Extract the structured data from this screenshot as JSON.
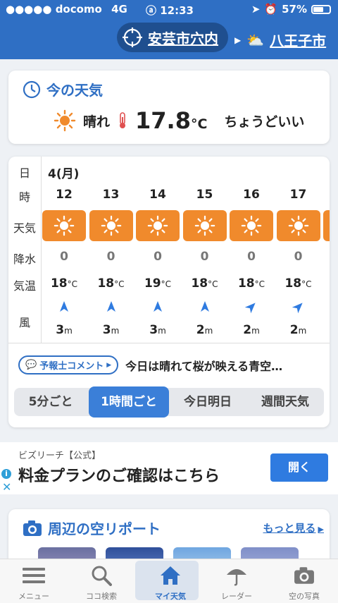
{
  "status": {
    "carrier": "docomo",
    "network": "4G",
    "time": "12:33",
    "battery": "57%",
    "battery_level": 0.57
  },
  "location": {
    "current": "安芸市穴内",
    "next": "八王子市"
  },
  "now": {
    "title": "今の天気",
    "weather": "晴れ",
    "temp": "17.8",
    "unit": "°C",
    "feel": "ちょうどいい"
  },
  "forecast": {
    "labels": {
      "day": "日",
      "hour": "時",
      "weather": "天気",
      "precip": "降水",
      "temp": "気温",
      "wind": "風"
    },
    "date": "4(月)",
    "hours": [
      {
        "hour": "12",
        "precip": "0",
        "temp": "18",
        "wind": "3",
        "dir": "north"
      },
      {
        "hour": "13",
        "precip": "0",
        "temp": "18",
        "wind": "3",
        "dir": "north"
      },
      {
        "hour": "14",
        "precip": "0",
        "temp": "19",
        "wind": "3",
        "dir": "north"
      },
      {
        "hour": "15",
        "precip": "0",
        "temp": "18",
        "wind": "2",
        "dir": "north"
      },
      {
        "hour": "16",
        "precip": "0",
        "temp": "18",
        "wind": "2",
        "dir": "northeast"
      },
      {
        "hour": "17",
        "precip": "0",
        "temp": "18",
        "wind": "2",
        "dir": "northeast"
      }
    ],
    "temp_unit": "°C",
    "wind_unit": "m"
  },
  "comment": {
    "badge": "予報士コメント",
    "text": "今日は晴れて桜が映える青空…"
  },
  "segments": {
    "opt1": "5分ごと",
    "opt2": "1時間ごと",
    "opt3": "今日明日",
    "opt4": "週間天気",
    "active": "1時間ごと"
  },
  "ad": {
    "source": "ビズリーチ【公式】",
    "text": "料金プランのご確認はこちら",
    "button": "開く"
  },
  "report": {
    "title": "周辺の空リポート",
    "more": "もっと見る"
  },
  "tabs": {
    "menu": "メニュー",
    "search": "ココ検索",
    "my": "マイ天気",
    "radar": "レーダー",
    "photo": "空の写真"
  },
  "colors": {
    "brand": "#2f6fc4",
    "sunny_bg": "#f08a2c",
    "accent": "#3b7fd8"
  }
}
